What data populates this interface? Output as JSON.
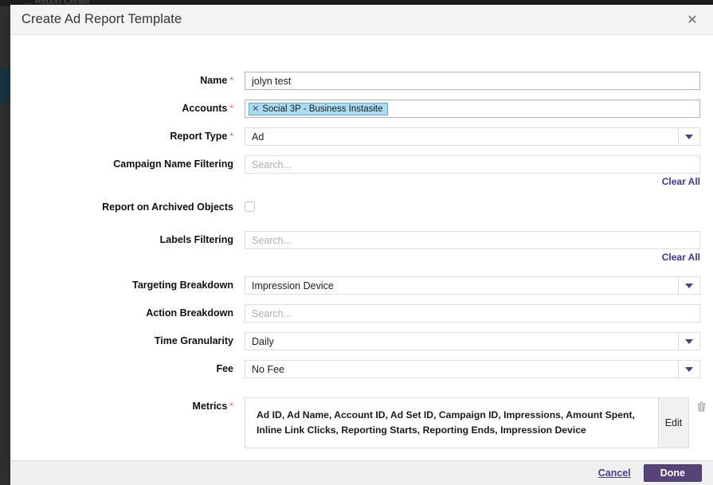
{
  "background": {
    "nav_hint": "…     Report Center"
  },
  "modal": {
    "title": "Create Ad Report Template",
    "close_icon": "close-icon",
    "fields": [
      {
        "label": "Name",
        "required": true,
        "type": "text",
        "value": "jolyn test",
        "placeholder": ""
      },
      {
        "label": "Accounts",
        "required": true,
        "type": "chips",
        "chips": [
          {
            "remove_icon": "✕",
            "text": "Social 3P - Business Instasite"
          }
        ]
      },
      {
        "label": "Report Type",
        "required": true,
        "type": "select",
        "value": "Ad"
      },
      {
        "label": "Campaign Name Filtering",
        "required": false,
        "type": "search",
        "value": "",
        "placeholder": "Search...",
        "clear_label": "Clear All"
      },
      {
        "label": "Report on Archived Objects",
        "required": false,
        "type": "checkbox",
        "checked": false
      },
      {
        "label": "Labels Filtering",
        "required": false,
        "type": "search",
        "value": "",
        "placeholder": "Search...",
        "clear_label": "Clear All"
      },
      {
        "label": "Targeting Breakdown",
        "required": false,
        "type": "select",
        "value": "Impression Device"
      },
      {
        "label": "Action Breakdown",
        "required": false,
        "type": "search",
        "value": "",
        "placeholder": "Search..."
      },
      {
        "label": "Time Granularity",
        "required": false,
        "type": "select",
        "value": "Daily"
      },
      {
        "label": "Fee",
        "required": false,
        "type": "select",
        "value": "No Fee"
      }
    ],
    "metrics": {
      "label": "Metrics",
      "required": true,
      "value": "Ad ID, Ad Name, Account ID, Ad Set ID, Campaign ID, Impressions, Amount Spent, Inline Link Clicks, Reporting Starts, Reporting Ends, Impression Device",
      "edit_label": "Edit",
      "delete_icon": "trash-icon"
    },
    "footer": {
      "cancel_label": "Cancel",
      "done_label": "Done"
    }
  },
  "colors": {
    "accent_purple": "#564378",
    "link_blue": "#3a33a8",
    "required_red": "#e8635f",
    "chip_blue": "#a9dcf0"
  }
}
